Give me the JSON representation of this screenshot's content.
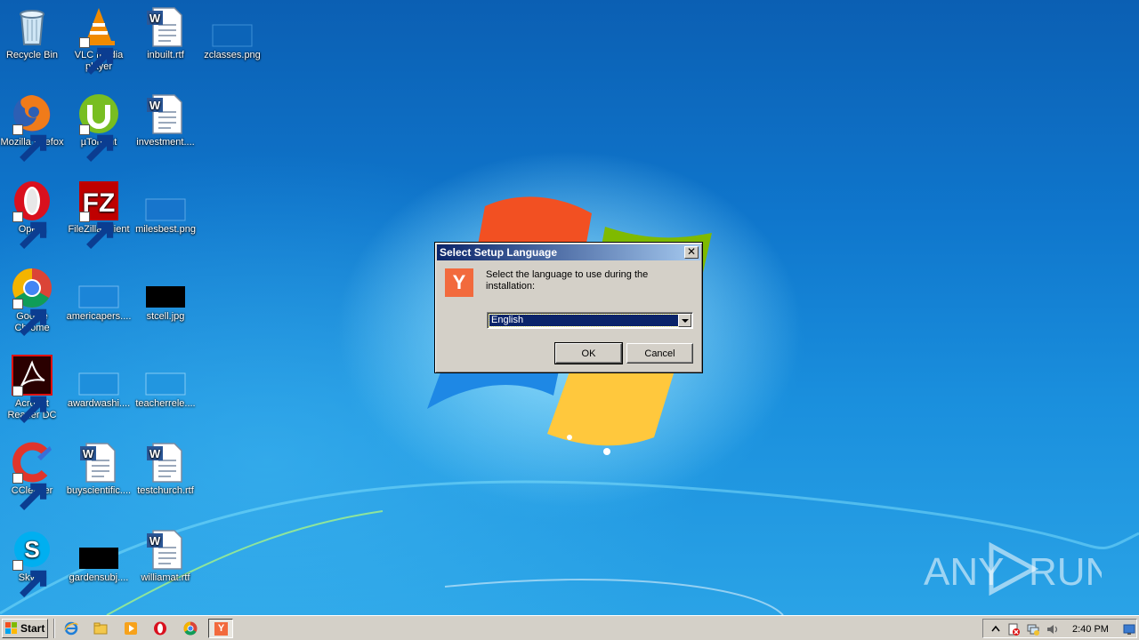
{
  "desktop": {
    "icons": [
      {
        "label": "Recycle Bin",
        "icon": "recycle-bin-icon"
      },
      {
        "label": "VLC media player",
        "icon": "vlc-icon"
      },
      {
        "label": "inbuilt.rtf",
        "icon": "word-document-icon"
      },
      {
        "label": "zclasses.png",
        "icon": "image-file-icon"
      },
      {
        "label": "Mozilla Firefox",
        "icon": "firefox-icon"
      },
      {
        "label": "µTorrent",
        "icon": "utorrent-icon"
      },
      {
        "label": "investment....",
        "icon": "word-document-icon"
      },
      {
        "label": "Opera",
        "icon": "opera-icon"
      },
      {
        "label": "FileZilla Client",
        "icon": "filezilla-icon"
      },
      {
        "label": "milesbest.png",
        "icon": "image-file-icon"
      },
      {
        "label": "Google Chrome",
        "icon": "chrome-icon"
      },
      {
        "label": "americapers....",
        "icon": "image-file-icon"
      },
      {
        "label": "stcell.jpg",
        "icon": "image-file-icon"
      },
      {
        "label": "Acrobat Reader DC",
        "icon": "acrobat-icon"
      },
      {
        "label": "awardwashi....",
        "icon": "image-file-icon"
      },
      {
        "label": "teacherrele....",
        "icon": "image-file-icon"
      },
      {
        "label": "CCleaner",
        "icon": "ccleaner-icon"
      },
      {
        "label": "buyscientific....",
        "icon": "word-document-icon"
      },
      {
        "label": "testchurch.rtf",
        "icon": "word-document-icon"
      },
      {
        "label": "Skype",
        "icon": "skype-icon"
      },
      {
        "label": "gardensubj....",
        "icon": "image-file-icon"
      },
      {
        "label": "williamat.rtf",
        "icon": "word-document-icon"
      }
    ]
  },
  "dialog": {
    "title": "Select Setup Language",
    "close_glyph": "✕",
    "app_icon_letter": "Y",
    "message": "Select the language to use during the installation:",
    "language_selected": "English",
    "ok_label": "OK",
    "cancel_label": "Cancel"
  },
  "watermark": {
    "text_left": "ANY",
    "text_right": "RUN"
  },
  "taskbar": {
    "start_label": "Start",
    "quick_launch": [
      "internet-explorer-icon",
      "windows-explorer-icon",
      "media-player-icon",
      "opera-icon",
      "chrome-icon"
    ],
    "active_task_letter": "Y",
    "clock": "2:40 PM"
  },
  "colors": {
    "dialog_face": "#d4d0c8",
    "title_gradient_start": "#0a246a",
    "title_gradient_end": "#a6caf0",
    "installer_accent": "#f26a3d"
  }
}
